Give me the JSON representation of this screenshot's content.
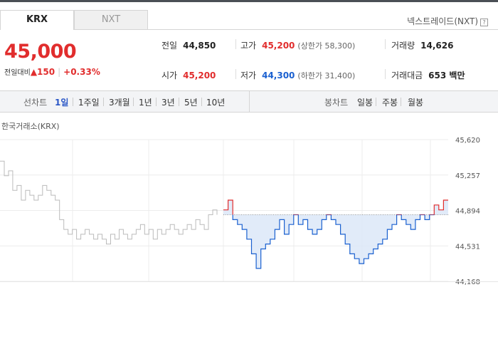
{
  "tabs": [
    {
      "label": "KRX"
    },
    {
      "label": "NXT"
    }
  ],
  "nxt_link": "넥스트레이드(NXT)",
  "nxt_help": "?",
  "price": "45,000",
  "change": {
    "label": "전일대비",
    "arrow": "▲",
    "amount": "150",
    "percent": "+0.33%"
  },
  "stats": {
    "prev": {
      "label": "전일",
      "value": "44,850"
    },
    "open": {
      "label": "시가",
      "value": "45,200"
    },
    "high": {
      "label": "고가",
      "value": "45,200",
      "sub": "(상한가 58,300)"
    },
    "low": {
      "label": "저가",
      "value": "44,300",
      "sub": "(하한가 31,400)"
    },
    "volume": {
      "label": "거래량",
      "value": "14,626"
    },
    "amount": {
      "label": "거래대금",
      "value": "653 백만"
    }
  },
  "line_chart_label": "선차트",
  "periods": [
    "1일",
    "1주일",
    "3개월",
    "1년",
    "3년",
    "5년",
    "10년"
  ],
  "candle_chart_label": "봉차트",
  "candle_periods": [
    "일봉",
    "주봉",
    "월봉"
  ],
  "colors": {
    "up": "#e12d2d",
    "down": "#1a60d0",
    "gray": "#bbbbbb",
    "fill": "#dce8f8"
  },
  "chart_data": {
    "type": "line",
    "title": "한국거래소(KRX)",
    "yticks": [
      "45,620",
      "45,257",
      "44,894",
      "44,531",
      "44,168"
    ],
    "ylim": [
      44168,
      45620
    ],
    "baseline": 44850,
    "grid": true,
    "series": [
      {
        "segment": "previous",
        "values": [
          45400,
          45250,
          45300,
          45100,
          45150,
          45000,
          45100,
          45050,
          45000,
          45050,
          45150,
          45100,
          45050,
          45000,
          44800,
          44700,
          44650,
          44700,
          44600,
          44650,
          44700,
          44650,
          44600,
          44650,
          44600,
          44550,
          44650,
          44600,
          44700,
          44650,
          44600,
          44650,
          44700,
          44750,
          44650,
          44700,
          44600,
          44700,
          44650,
          44700,
          44750,
          44700,
          44650,
          44700,
          44750,
          44700,
          44800,
          44750,
          44700,
          44850,
          44900,
          44850
        ]
      },
      {
        "segment": "today",
        "values": [
          44900,
          45000,
          44800,
          44750,
          44700,
          44600,
          44450,
          44300,
          44500,
          44550,
          44600,
          44700,
          44800,
          44650,
          44750,
          44850,
          44750,
          44800,
          44700,
          44650,
          44700,
          44800,
          44850,
          44800,
          44750,
          44650,
          44550,
          44450,
          44400,
          44350,
          44400,
          44450,
          44500,
          44550,
          44600,
          44700,
          44750,
          44850,
          44800,
          44750,
          44700,
          44800,
          44850,
          44800,
          44850,
          44950,
          44900,
          45000,
          45000
        ]
      }
    ]
  }
}
